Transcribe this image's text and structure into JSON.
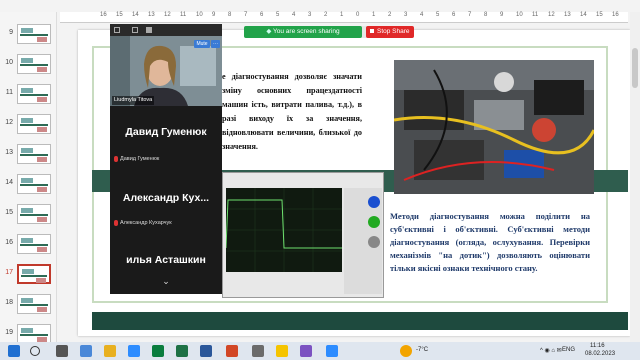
{
  "app": {
    "accent": "#c0392b",
    "slide_accent": "#2f5d4e"
  },
  "thumbnails": {
    "items": [
      {
        "num": "9"
      },
      {
        "num": "10"
      },
      {
        "num": "11"
      },
      {
        "num": "12"
      },
      {
        "num": "13"
      },
      {
        "num": "14"
      },
      {
        "num": "15"
      },
      {
        "num": "16"
      },
      {
        "num": "17"
      },
      {
        "num": "18"
      },
      {
        "num": "19"
      }
    ],
    "active": "17"
  },
  "ruler": {
    "ticks": [
      "16",
      "15",
      "14",
      "13",
      "12",
      "11",
      "10",
      "9",
      "8",
      "7",
      "6",
      "5",
      "4",
      "3",
      "2",
      "1",
      "0",
      "1",
      "2",
      "3",
      "4",
      "5",
      "6",
      "7",
      "8",
      "9",
      "10",
      "11",
      "12",
      "13",
      "14",
      "15",
      "16"
    ]
  },
  "zoom": {
    "sharing_text": "You are screen sharing",
    "stop_share": "Stop Share",
    "mute": "Mute",
    "more": "···",
    "presenter_label": "Liudmyla Titova",
    "participants": [
      {
        "name": "Давид Гуменюк",
        "label": "Давид Гуменюк"
      },
      {
        "name": "Александр  Кух...",
        "label": "Александр Кухарчук"
      },
      {
        "name": "илья Асташкин",
        "label": ""
      }
    ],
    "chevron": "⌄"
  },
  "slide": {
    "para1": "е діагностування дозволяє значати зміну основних працездатності машин ість, витрати палива, т.д.), в разі виходу їх за значення, відновлювати величини, близької до значення.",
    "para2": "Методи діагностування можна поділити на суб'єктивні і об'єктивні. Суб'єктивні методи діагностування (огляда, ослухування. Перевірки механізмів \"на дотик\") дозволяють оцінювати тільки якісні ознаки технічного стану."
  },
  "taskbar": {
    "temperature": "-7°C",
    "language": "ENG",
    "time": "11:16",
    "date": "08.02.2023"
  }
}
